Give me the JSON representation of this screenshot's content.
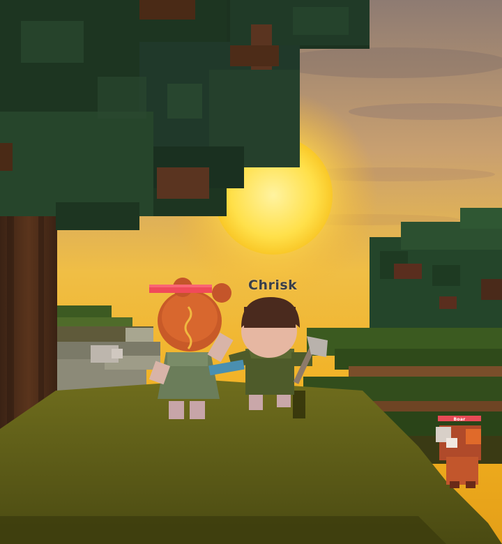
{
  "players": [
    {
      "name": "",
      "health": 1.0
    },
    {
      "name": "Chrisk"
    }
  ],
  "mob": {
    "name": "Boar",
    "health": 1.0
  },
  "colors": {
    "sky_top": "#8f7a6e",
    "sky_glow": "#f7c230",
    "sun": "#ffe066",
    "grass": "#6c6a1c",
    "leaves": "#1f3a22",
    "health_bar": "#f04a5a"
  }
}
